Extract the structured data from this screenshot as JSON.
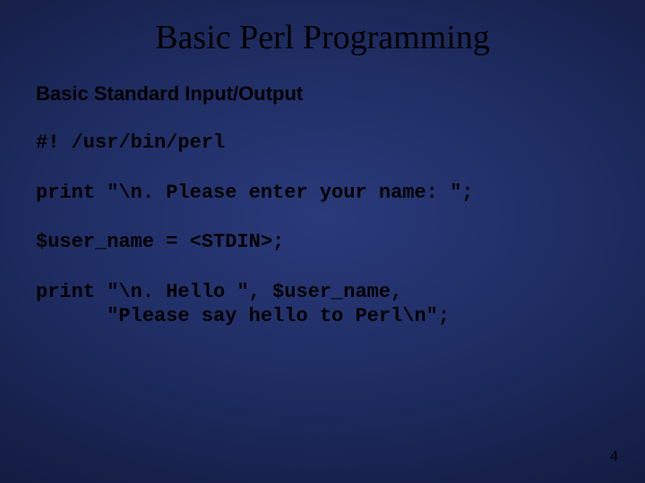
{
  "title": "Basic Perl Programming",
  "subtitle": "Basic Standard Input/Output",
  "code": {
    "l1": "#! /usr/bin/perl",
    "l2": "print \"\\n. Please enter your name: \";",
    "l3": "$user_name = <STDIN>;",
    "l4": "print \"\\n. Hello \", $user_name,",
    "l5": "      \"Please say hello to Perl\\n\";"
  },
  "page_number": "4"
}
